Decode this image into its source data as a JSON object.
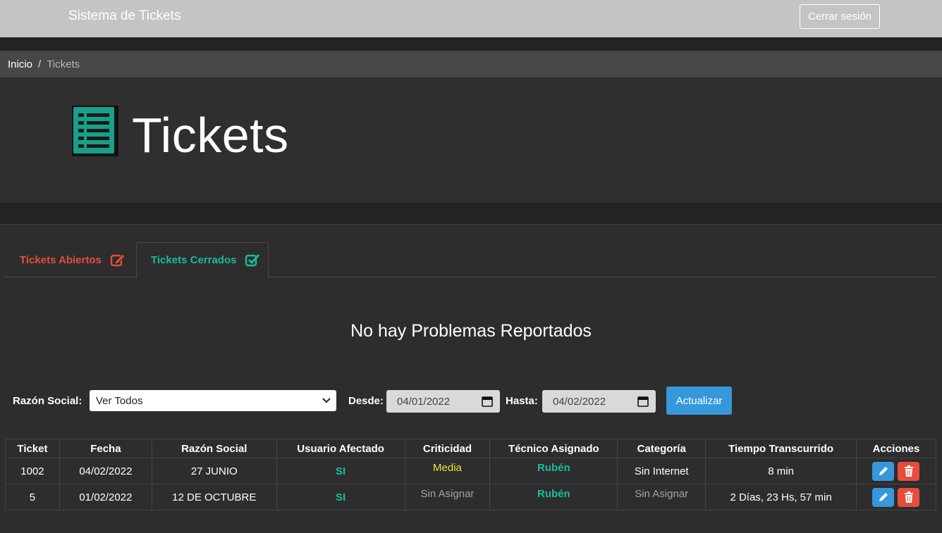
{
  "navbar": {
    "brand": "Sistema de Tickets",
    "logout_label": "Cerrar sesión"
  },
  "breadcrumb": {
    "home": "Inicio",
    "separator": "/",
    "current": "Tickets"
  },
  "hero": {
    "title": "Tickets",
    "icon": "list-icon"
  },
  "tabs": [
    {
      "label": "Tickets Abiertos",
      "icon": "edit-icon",
      "color": "#e74c3c"
    },
    {
      "label": "Tickets Cerrados",
      "icon": "check-square-icon",
      "color": "#18bc9c",
      "active": true
    }
  ],
  "empty_message": "No hay Problemas Reportados",
  "filters": {
    "razon_label": "Razón Social:",
    "razon_value": "Ver Todos",
    "desde_label": "Desde:",
    "desde_value": "04/01/2022",
    "hasta_label": "Hasta:",
    "hasta_value": "04/02/2022",
    "update_label": "Actualizar"
  },
  "table": {
    "headers": [
      "Ticket",
      "Fecha",
      "Razón Social",
      "Usuario Afectado",
      "Criticidad",
      "Técnico Asignado",
      "Categoría",
      "Tiempo Transcurrido",
      "Acciones"
    ],
    "rows": [
      {
        "ticket": "1002",
        "fecha": "04/02/2022",
        "razon": "27 JUNIO",
        "usuario": "SI",
        "criticidad": "Media",
        "tecnico": "Rubén",
        "categoria": "Sin Internet",
        "tiempo": "8 min"
      },
      {
        "ticket": "5",
        "fecha": "01/02/2022",
        "razon": "12 DE OCTUBRE",
        "usuario": "SI",
        "criticidad": "Sin Asignar",
        "tecnico": "Rubén",
        "categoria": "Sin Asignar",
        "tiempo": "2 Días, 23 Hs, 57 min"
      }
    ]
  },
  "colors": {
    "accent_teal": "#18bc9c",
    "accent_red": "#e74c3c",
    "accent_blue": "#3498db",
    "warning_yellow": "#f1e03a"
  }
}
